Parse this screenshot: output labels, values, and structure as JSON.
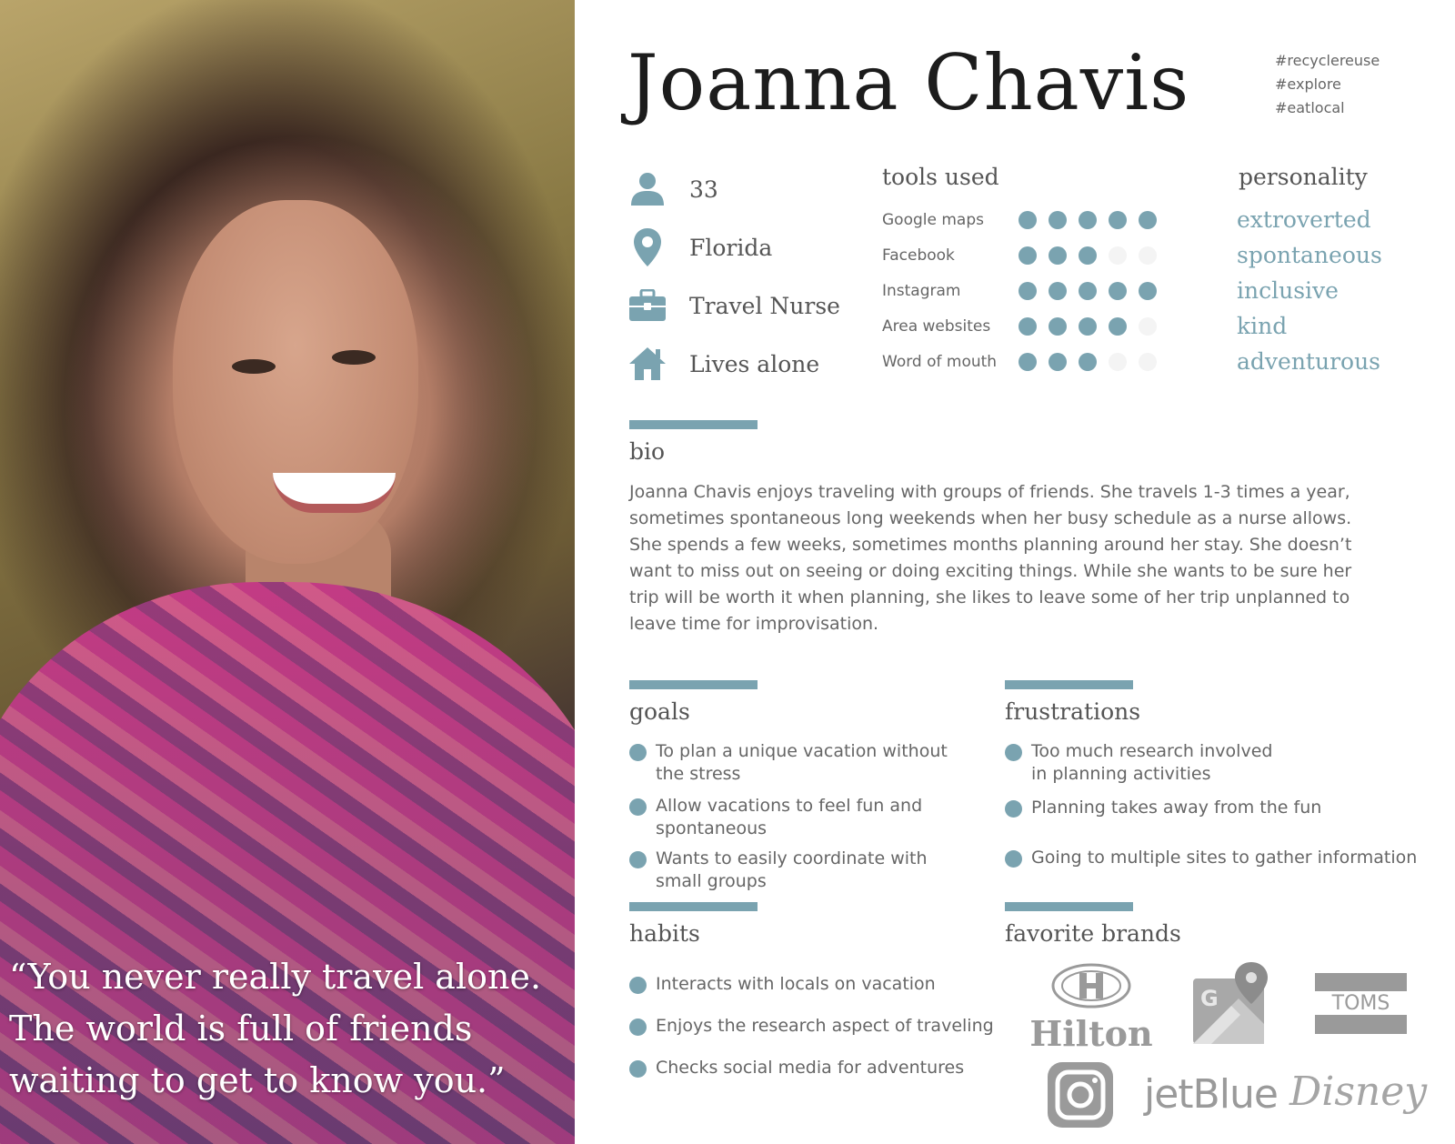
{
  "persona": {
    "name": "Joanna Chavis",
    "hashtags": [
      "#recyclereuse",
      "#explore",
      "#eatlocal"
    ],
    "quote": "“You never really travel alone. The world is full of friends waiting to get to know you.”"
  },
  "demographics": [
    {
      "icon": "person-icon",
      "value": "33"
    },
    {
      "icon": "location-pin-icon",
      "value": "Florida"
    },
    {
      "icon": "briefcase-icon",
      "value": "Travel Nurse"
    },
    {
      "icon": "home-icon",
      "value": "Lives alone"
    }
  ],
  "tools": {
    "title": "tools used",
    "max": 5,
    "items": [
      {
        "name": "Google maps",
        "rating": 5
      },
      {
        "name": "Facebook",
        "rating": 3
      },
      {
        "name": "Instagram",
        "rating": 5
      },
      {
        "name": "Area websites",
        "rating": 4
      },
      {
        "name": "Word of mouth",
        "rating": 3
      }
    ]
  },
  "personality": {
    "title": "personality",
    "traits": [
      "extroverted",
      "spontaneous",
      "inclusive",
      "kind",
      "adventurous"
    ]
  },
  "bio": {
    "title": "bio",
    "text": "Joanna Chavis enjoys traveling with groups of friends. She travels 1-3 times a year, sometimes spontaneous long weekends when her busy schedule as a nurse allows. She spends a few weeks, sometimes months planning around her stay. She doesn’t want to miss out on seeing or doing exciting things. While she wants to be sure her trip will be worth it when planning, she likes to leave some of her trip unplanned to leave time for improvisation."
  },
  "goals": {
    "title": "goals",
    "items": [
      "To plan a unique vacation without the stress",
      "Allow vacations to feel fun and spontaneous",
      "Wants to easily coordinate with small groups"
    ]
  },
  "frustrations": {
    "title": "frustrations",
    "items": [
      "Too much research involved in planning activities",
      "Planning takes away from the fun",
      "Going to multiple sites to gather information"
    ]
  },
  "habits": {
    "title": "habits",
    "items": [
      "Interacts with locals on vacation",
      "Enjoys the research aspect of traveling",
      "Checks social media for adventures"
    ]
  },
  "brands": {
    "title": "favorite brands",
    "hilton": "Hilton",
    "toms": "TOMS",
    "jetblue": "jetBlue",
    "disney": "Disney",
    "google_maps_letter": "G"
  },
  "colors": {
    "accent": "#7aa3b0",
    "dot_off": "#f4f4f4",
    "heading": "#1c1c1c",
    "text": "#666666",
    "logo_gray": "#9a9a9a"
  }
}
